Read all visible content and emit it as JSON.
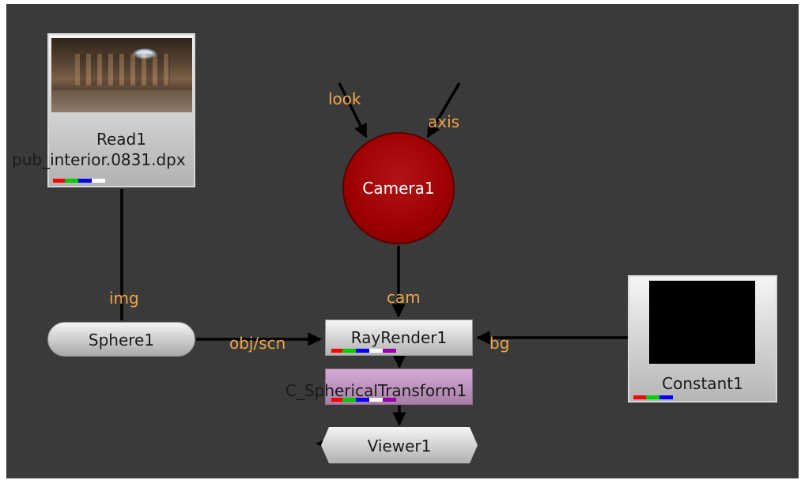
{
  "nodes": {
    "read1": {
      "name": "Read1",
      "file": "pub_interior.0831.dpx"
    },
    "camera1": {
      "name": "Camera1"
    },
    "sphere1": {
      "name": "Sphere1"
    },
    "rayrender1": {
      "name": "RayRender1"
    },
    "spherical1": {
      "name": "C_SphericalTransform1"
    },
    "constant1": {
      "name": "Constant1"
    },
    "viewer1": {
      "name": "Viewer1"
    }
  },
  "inputs": {
    "look": "look",
    "axis": "axis",
    "img": "img",
    "cam": "cam",
    "obj_scn": "obj/scn",
    "bg": "bg"
  },
  "colors": {
    "graph_background": "#3a3a3a",
    "input_label": "#f0a648",
    "camera_node": "#9c0000",
    "transform_node": "#c39ac3",
    "channel_red": "#ff0000",
    "channel_green": "#00cc00",
    "channel_blue": "#0000ff",
    "channel_alpha": "#ffffff",
    "channel_extra": "#9900aa"
  }
}
